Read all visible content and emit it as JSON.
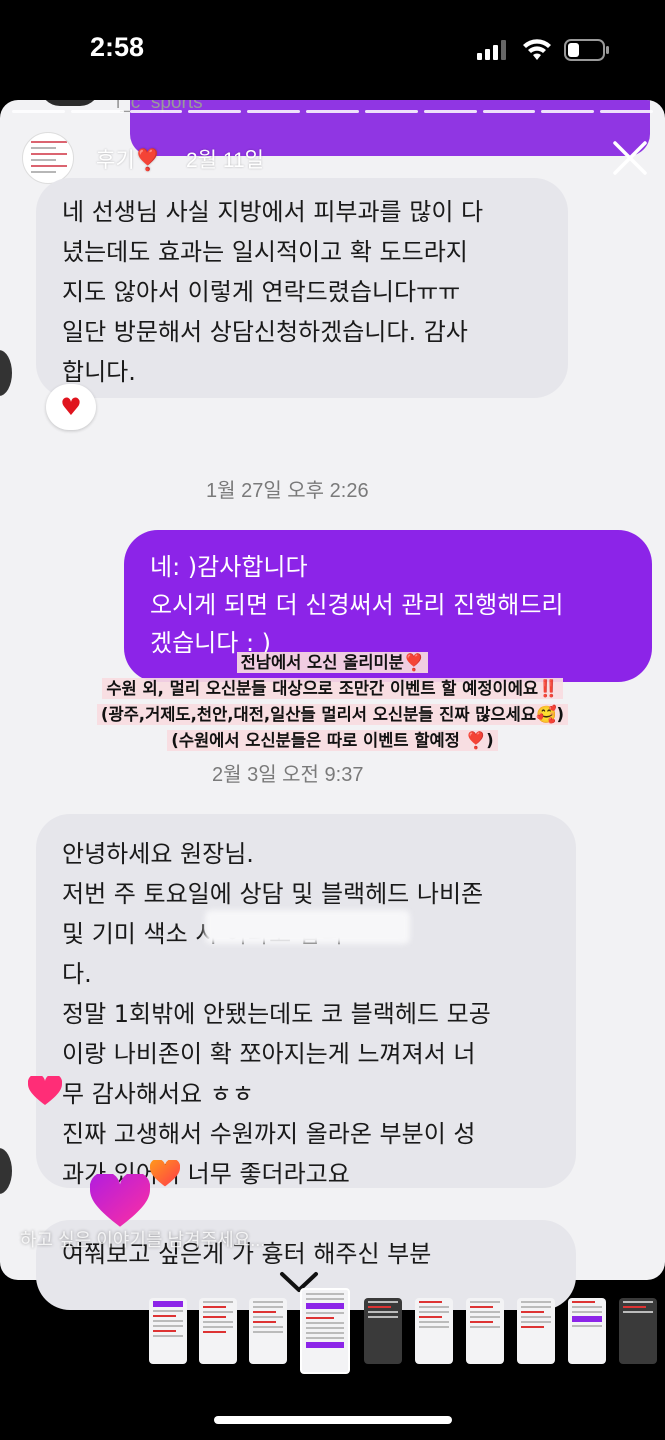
{
  "status_bar": {
    "time": "2:58"
  },
  "story": {
    "peek_username": "i_c_sports",
    "title": "후기❣️",
    "date": "2월 11일",
    "reply_placeholder": "하고 싶은 이야기를 남겨주세요..."
  },
  "messages": [
    {
      "text": "네 선생님 사실 지방에서 피부과를 많이 다\n녔는데도 효과는 일시적이고 확 도드라지\n지도 않아서 이렇게 연락드렸습니다ㅠㅠ\n일단 방문해서 상담신청하겠습니다. 감사\n합니다."
    },
    {
      "text": "네: )감사합니다\n오시게 되면 더 신경써서 관리 진행해드리\n겠습니다 : )"
    },
    {
      "text": "안녕하세요 원장님.\n저번 주 토요일에 상담 및 블랙헤드 나비존\n및 기미 색소 시          이라고 합니\n다.\n정말 1회밖에 안됐는데도 코 블랙헤드 모공\n이랑 나비존이 확 쪼아지는게 느껴져서 너\n무 감사해서요 ㅎㅎ\n진짜 고생해서 수원까지 올라온 부분이 성\n과가 있어서 너무 좋더라고요"
    },
    {
      "text": "여쭤보고 싶은게 가 흉터 해주신 부분"
    }
  ],
  "reaction": "♥",
  "timestamps": [
    "1월 27일 오후 2:26",
    "2월 3일 오전 9:37"
  ],
  "caption": [
    "전남에서 오신 올리미분❣️",
    "수원 외, 멀리 오신분들 대상으로 조만간 이벤트 할 예정이에요‼️",
    "(광주,거제도,천안,대전,일산들 멀리서 오신분들 진짜 많으세요🥰)",
    "(수원에서 오신분들은 따로 이벤트 할예정 ❣️)"
  ],
  "colors": {
    "outgoing_bubble": "#8c24e8",
    "incoming_bubble": "#e6e6eb",
    "caption_highlight": "#f8dce0"
  }
}
